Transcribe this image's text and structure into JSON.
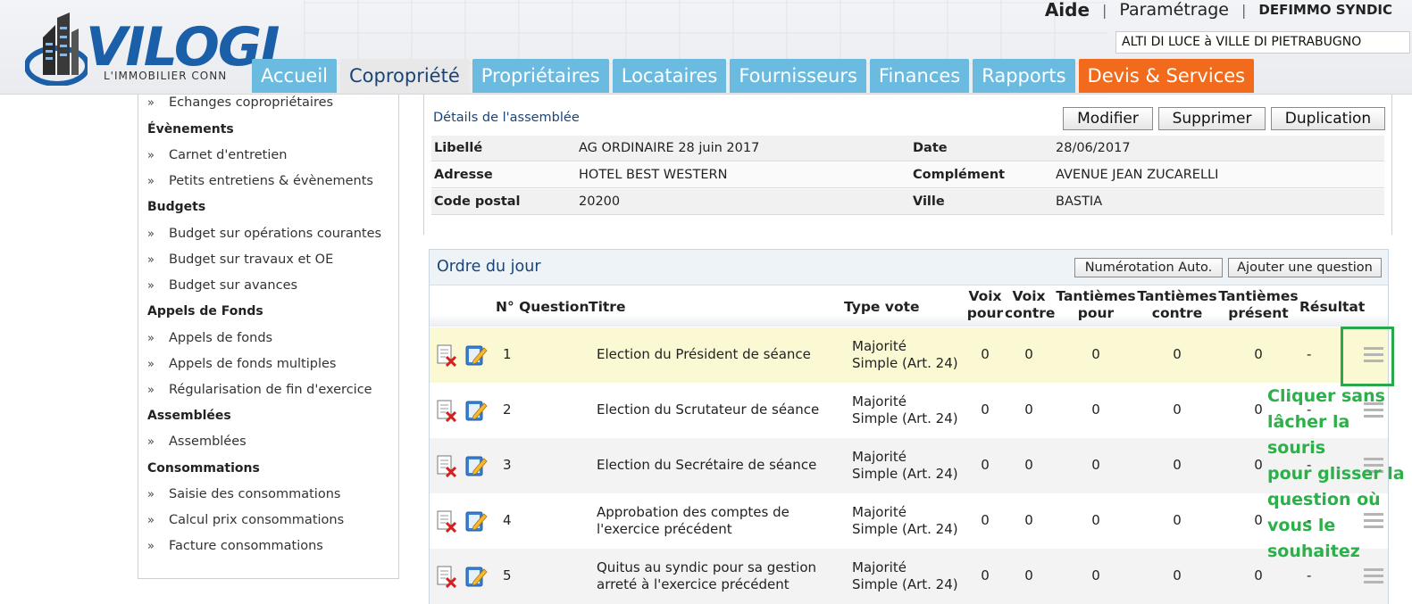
{
  "header": {
    "logo_text": "VILOGI",
    "logo_sub": "L'IMMOBILIER CONN",
    "links": {
      "aide": "Aide",
      "parametrage": "Paramétrage",
      "user": "DEFIMMO SYNDIC",
      "sep": "|"
    },
    "copro": "ALTI DI LUCE à VILLE DI PIETRABUGNO",
    "tabs": [
      {
        "label": "Accueil"
      },
      {
        "label": "Copropriété"
      },
      {
        "label": "Propriétaires"
      },
      {
        "label": "Locataires"
      },
      {
        "label": "Fournisseurs"
      },
      {
        "label": "Finances"
      },
      {
        "label": "Rapports"
      },
      {
        "label": "Devis & Services"
      }
    ]
  },
  "sidebar": {
    "arrow": "»",
    "items": [
      {
        "type": "item",
        "label": "Echanges copropriétaires"
      },
      {
        "type": "head",
        "label": "Évènements"
      },
      {
        "type": "item",
        "label": "Carnet d'entretien"
      },
      {
        "type": "item",
        "label": "Petits entretiens & évènements"
      },
      {
        "type": "head",
        "label": "Budgets"
      },
      {
        "type": "item",
        "label": "Budget sur opérations courantes"
      },
      {
        "type": "item",
        "label": "Budget sur travaux et OE"
      },
      {
        "type": "item",
        "label": "Budget sur avances"
      },
      {
        "type": "head",
        "label": "Appels de Fonds"
      },
      {
        "type": "item",
        "label": "Appels de fonds"
      },
      {
        "type": "item",
        "label": "Appels de fonds multiples"
      },
      {
        "type": "item",
        "label": "Régularisation de fin d'exercice"
      },
      {
        "type": "head",
        "label": "Assemblées"
      },
      {
        "type": "item",
        "label": "Assemblées"
      },
      {
        "type": "head",
        "label": "Consommations"
      },
      {
        "type": "item",
        "label": "Saisie des consommations"
      },
      {
        "type": "item",
        "label": "Calcul prix consommations"
      },
      {
        "type": "item",
        "label": "Facture consommations"
      }
    ]
  },
  "details": {
    "title": "Détails de l'assemblée",
    "buttons": {
      "modifier": "Modifier",
      "supprimer": "Supprimer",
      "duplication": "Duplication"
    },
    "fields": {
      "libelle_label": "Libellé",
      "libelle": "AG ORDINAIRE 28 juin 2017",
      "date_label": "Date",
      "date": "28/06/2017",
      "adresse_label": "Adresse",
      "adresse": "HOTEL BEST WESTERN",
      "complement_label": "Complément",
      "complement": "AVENUE JEAN ZUCARELLI",
      "cp_label": "Code postal",
      "cp": "20200",
      "ville_label": "Ville",
      "ville": "BASTIA"
    }
  },
  "agenda": {
    "title": "Ordre du jour",
    "buttons": {
      "auto": "Numérotation Auto.",
      "add": "Ajouter une question"
    },
    "columns": {
      "num": "N° Question",
      "titre": "Titre",
      "type": "Type vote",
      "voix_pour_1": "Voix",
      "voix_pour_2": "pour",
      "voix_contre_1": "Voix",
      "voix_contre_2": "contre",
      "tant_pour_1": "Tantièmes",
      "tant_pour_2": "pour",
      "tant_contre_1": "Tantièmes",
      "tant_contre_2": "contre",
      "tant_present_1": "Tantièmes",
      "tant_present_2": "présent",
      "resultat": "Résultat"
    },
    "rows": [
      {
        "num": "1",
        "title1": "Election du Président de séance",
        "title2": "",
        "type1": "Majorité",
        "type2": "Simple (Art. 24)",
        "vp": "0",
        "vc": "0",
        "tp": "0",
        "tc": "0",
        "tpr": "0",
        "res": "-"
      },
      {
        "num": "2",
        "title1": "Election du Scrutateur de séance",
        "title2": "",
        "type1": "Majorité",
        "type2": "Simple (Art. 24)",
        "vp": "0",
        "vc": "0",
        "tp": "0",
        "tc": "0",
        "tpr": "0",
        "res": "-"
      },
      {
        "num": "3",
        "title1": "Election du Secrétaire de séance",
        "title2": "",
        "type1": "Majorité",
        "type2": "Simple (Art. 24)",
        "vp": "0",
        "vc": "0",
        "tp": "0",
        "tc": "0",
        "tpr": "0",
        "res": "-"
      },
      {
        "num": "4",
        "title1": "Approbation des comptes de",
        "title2": "l'exercice précédent",
        "type1": "Majorité",
        "type2": "Simple (Art. 24)",
        "vp": "0",
        "vc": "0",
        "tp": "0",
        "tc": "0",
        "tpr": "0",
        "res": "-"
      },
      {
        "num": "5",
        "title1": "Quitus au syndic pour sa gestion",
        "title2": "arreté à l'exercice précédent",
        "type1": "Majorité",
        "type2": "Simple (Art. 24)",
        "vp": "0",
        "vc": "0",
        "tp": "0",
        "tc": "0",
        "tpr": "0",
        "res": "-"
      }
    ]
  },
  "annotation": {
    "lines": [
      "Cliquer sans",
      "lâcher la souris",
      "pour glisser la",
      "question où",
      "vous le",
      "souhaitez"
    ],
    "color": "#2bb04a"
  },
  "colors": {
    "tab_blue": "#6bbadf",
    "tab_orange": "#f26b1d",
    "brand_blue": "#1a5fa8",
    "title_blue": "#19447a",
    "highlight_row": "#fbf9d3"
  }
}
